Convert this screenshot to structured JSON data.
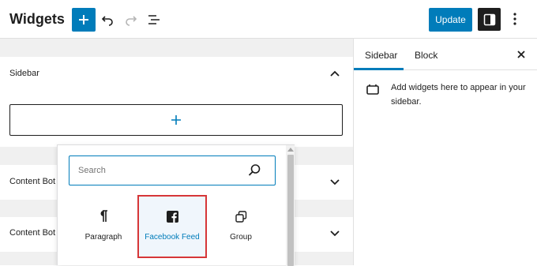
{
  "header": {
    "title": "Widgets",
    "update_label": "Update",
    "icons": [
      "plus-icon",
      "undo-icon",
      "redo-icon",
      "list-view-icon",
      "sidebar-toggle-icon",
      "more-options-icon"
    ]
  },
  "canvas": {
    "areas": [
      {
        "title": "Sidebar",
        "expanded": true
      },
      {
        "title": "Content Bot",
        "expanded": false
      },
      {
        "title": "Content Bot",
        "expanded": false
      }
    ]
  },
  "inserter": {
    "search_placeholder": "Search",
    "blocks": [
      {
        "label": "Paragraph",
        "icon": "paragraph-icon"
      },
      {
        "label": "Facebook Feed",
        "icon": "facebook-icon",
        "highlighted": true
      },
      {
        "label": "Group",
        "icon": "group-icon"
      }
    ]
  },
  "settings": {
    "tabs": [
      {
        "label": "Sidebar",
        "active": true
      },
      {
        "label": "Block",
        "active": false
      }
    ],
    "info_text": "Add widgets here to appear in your sidebar."
  },
  "colors": {
    "accent": "#007cba",
    "highlight_border": "#d63638",
    "dark": "#1e1e1e",
    "canvas_bg": "#f0f0f0"
  }
}
